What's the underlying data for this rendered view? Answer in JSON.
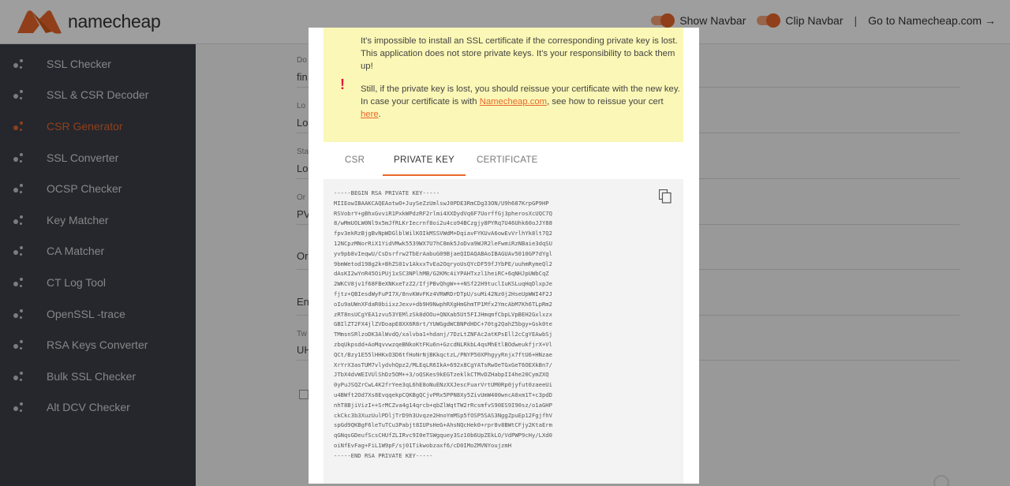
{
  "topbar": {
    "logo_text": "namecheap",
    "show_navbar": "Show Navbar",
    "clip_navbar": "Clip Navbar",
    "separator": "|",
    "goto": "Go to Namecheap.com →"
  },
  "sidebar": {
    "items": [
      {
        "label": "SSL Checker",
        "active": false
      },
      {
        "label": "SSL & CSR Decoder",
        "active": false
      },
      {
        "label": "CSR Generator",
        "active": true
      },
      {
        "label": "SSL Converter",
        "active": false
      },
      {
        "label": "OCSP Checker",
        "active": false
      },
      {
        "label": "Key Matcher",
        "active": false
      },
      {
        "label": "CA Matcher",
        "active": false
      },
      {
        "label": "CT Log Tool",
        "active": false
      },
      {
        "label": "OpenSSL -trace",
        "active": false
      },
      {
        "label": "RSA Keys Converter",
        "active": false
      },
      {
        "label": "Bulk SSL Checker",
        "active": false
      },
      {
        "label": "Alt DCV Checker",
        "active": false
      }
    ]
  },
  "background": {
    "labels": [
      "Do",
      "Lo",
      "Sta",
      "Or",
      "Tw"
    ],
    "values": [
      "fin",
      "Lo",
      "Lo",
      "PV",
      "Or",
      "En",
      "UH"
    ]
  },
  "modal": {
    "warning_mark": "!",
    "warning_p1": "It's impossible to install an SSL certificate if the corresponding private key is lost. This application does not store private keys. It's your responsibility to back them up!",
    "warning_p2_before": "Still, if the private key is lost, you should reissue your certificate with the new key. In case your certificate is with ",
    "warning_p2_link1": "Namecheap.com",
    "warning_p2_middle": ", see how to reissue your cert ",
    "warning_p2_link2": "here",
    "warning_p2_end": ".",
    "tabs": [
      "CSR",
      "PRIVATE KEY",
      "CERTIFICATE"
    ],
    "active_tab": "PRIVATE KEY",
    "private_key": "-----BEGIN RSA PRIVATE KEY-----\nMIIEowIBAAKCAQEAotwO+JuySeZzUmlswJ0PDE3RmCDg33ON/U9h687KrpGP9HP\nRSVobrY+gBhxGvviR1PxkWPdzRF2rlmi4XXDydVq6F7UorffGj3pherosXcUQC7Q\n8/wMmUOLW0Nl9x5mJfRLKrIecrnf8oi2u4co94BCzgjy8PYRq7U46Uhk60oJJY88\nfpv3ekRzBjgBvNpWDGlblWilKOIkMSSVWdM+DqiavFYKUvA6owEvVrlhYk8lt7Q2\n12NCpzMNorRiX1YidVMwk5539WX7U7hC8mk5JoDva9WJR2leFwmiRzNBaie3dqSU\nyv9pb8vIeqwU/CsDsrfrw2TbErAabuG09BjaeQIDAQABAoIBAGUAv5010GP7dYgl\n9bmWetod198g2k+BhZS01v1AkxxTvEa2OqryoUsQYcDF59fJYbPE/uuhmRymeQl2\ndAsKI2wYnR45OiPUj1xSC3NPlhMB/G2KMc4iYPAHTxzl1heiRC+6qNHJpUWbCqZ\n2WKCV8jv1f68FBeXNKxeTzZ2/IfjPBvQhgW+++NSf22H9tuclIuKSLuqHqDlxpJe\nfjtz+QBIesdWyFuPI7X/8nvKWvFKz4VRWRDrDTpU/suMi42Nz0j2HseUpWWI4F2J\noIu9aUWnXFdaR0biixzJexv+db9H9NwphRXgHmGhmTP1Mfx2YmcAbM7Kh6TLpRm2\nzRT8nsUCgYEA1zvu53YEMlzSk8dOOu+QNXab5Ut5FIJHmqmfCbpLVpBEH2Gxlxzx\nGBIlZT2FX4jlZVDoapE8XX6R8rt/YUWGgdWCBNPdHDC+70tg2QahZ5bgy+Gsk0te\nTMmsnSRlzoDK3AlWvdQ/xalvba1+hdanj/7DzLtZNFAc2atKPsEll2cCgYEAwbSj\nzbqUkpsdd+AoMqvvwzqeBNkoKtFKu6n+GzcdNLRkbL4qsMhEtlBOdweukfjrX+Vl\nQCt/Bzy1E55lHHKxO3D6tfHoNrNjBKkqctzL/PNYP50XPhgyyRnjx7ftU6+HNzae\nXrYrX3asTUM7vlydvhQpz2/MLEqLR6IkA+692x8CgYATsRwOeTGxGeT6OEXkBn7/\nJTbX4dvWEIVUlShDz5OM++3/oQSKes9kEGTzeklkCTMvDZHabpII4he20CymZXQ\n0yPuJSQZrCwL4K2frYee3qL6hE8oNuENzXXJescFuarVrtUM0Rp0jyfut0zaeeUi\nu4BWft2Od7Xs8EvqqekpCQKBgQCjvPRx5PPN8Xy5ZivUmW400wncA0xm1T+c3pdD\nnhT8BjiVizI++SrMCZva4g14qrcb+qbZlWqtTW2rRcsmfvS90ES9I90sz/o1aGHP\nckCkc3b3XuzUulPDljTrD9h3Uvqze2HnoYmMSp5fOSP5SAS3NggZpuEp12FgjfhV\nspGd9QKBgF6leTuTCu3Pabjt8IUPsHeG+AhsNQcHek0+rpr8v8BWtCFjy2KtaErm\nqGNqsGDeufScsCHUfZLIRvc9I0eTSWgquey3Sz10b6UpZEkLO/VdPWP9cHy/LXd0\noiNfEvFag+FiL1W9pF/sj01Tikwobzaxf6/cD0IMoZMVNYoujzmH\n-----END RSA PRIVATE KEY-----"
  },
  "colors": {
    "accent": "#e8672a",
    "sidebar_bg": "#3c4049",
    "warning_bg": "#fbf7b6",
    "warning_mark": "#e0163a"
  },
  "icons": {
    "copy": "copy-icon",
    "logo": "namecheap-logo-icon"
  }
}
